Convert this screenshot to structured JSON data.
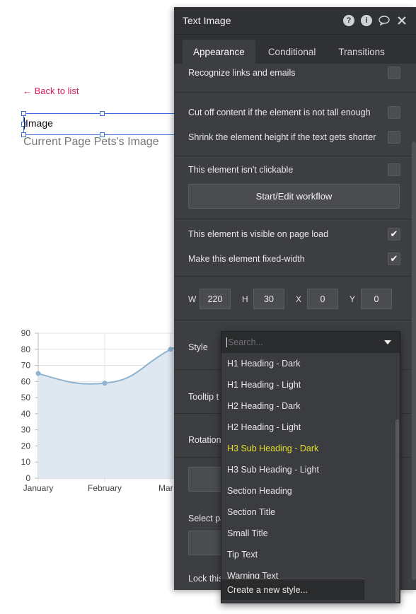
{
  "canvas": {
    "back_link": "← Back to list",
    "selected_text": "Image",
    "pet_image_label": "Current Page Pets's Image"
  },
  "chart_data": {
    "type": "area",
    "categories": [
      "January",
      "February",
      "March"
    ],
    "values": [
      65,
      59,
      80
    ],
    "ylim": [
      0,
      90
    ],
    "yticks": [
      0,
      10,
      20,
      30,
      40,
      50,
      60,
      70,
      80,
      90
    ],
    "grid": true,
    "fill_color": "#dfe8f1",
    "line_color": "#8fb3cf",
    "x_labels_shown": [
      "January",
      "February",
      "Mar"
    ]
  },
  "panel": {
    "title": "Text Image",
    "header_icons": [
      "help-icon",
      "info-icon",
      "comment-icon",
      "close-icon"
    ],
    "tabs": [
      "Appearance",
      "Conditional",
      "Transitions"
    ],
    "active_tab": "Appearance",
    "recognize_links": "Recognize links and emails",
    "cut_off": "Cut off content if the element is not tall enough",
    "shrink_height": "Shrink the element height if the text gets shorter",
    "not_clickable": "This element isn't clickable",
    "workflow_button": "Start/Edit workflow",
    "visible_on_load": "This element is visible on page load",
    "fixed_width": "Make this element fixed-width",
    "w_label": "W",
    "w_value": "220",
    "h_label": "H",
    "h_value": "30",
    "x_label": "X",
    "x_value": "0",
    "y_label": "Y",
    "y_value": "0",
    "style_label": "Style",
    "tooltip_label": "Tooltip t",
    "rotation_label": "Rotation",
    "select_label": "Select pa",
    "lock_label": "Lock this"
  },
  "dropdown": {
    "search_placeholder": "Search...",
    "items": [
      "H1 Heading - Dark",
      "H1 Heading - Light",
      "H2 Heading - Dark",
      "H2 Heading - Light",
      "H3 Sub Heading - Dark",
      "H3 Sub Heading - Light",
      "Section Heading",
      "Section Title",
      "Small Title",
      "Tip Text",
      "Warning Text"
    ],
    "selected_index": 4,
    "create_label": "Create a new style...",
    "highlight_color": "#e3e02a"
  }
}
